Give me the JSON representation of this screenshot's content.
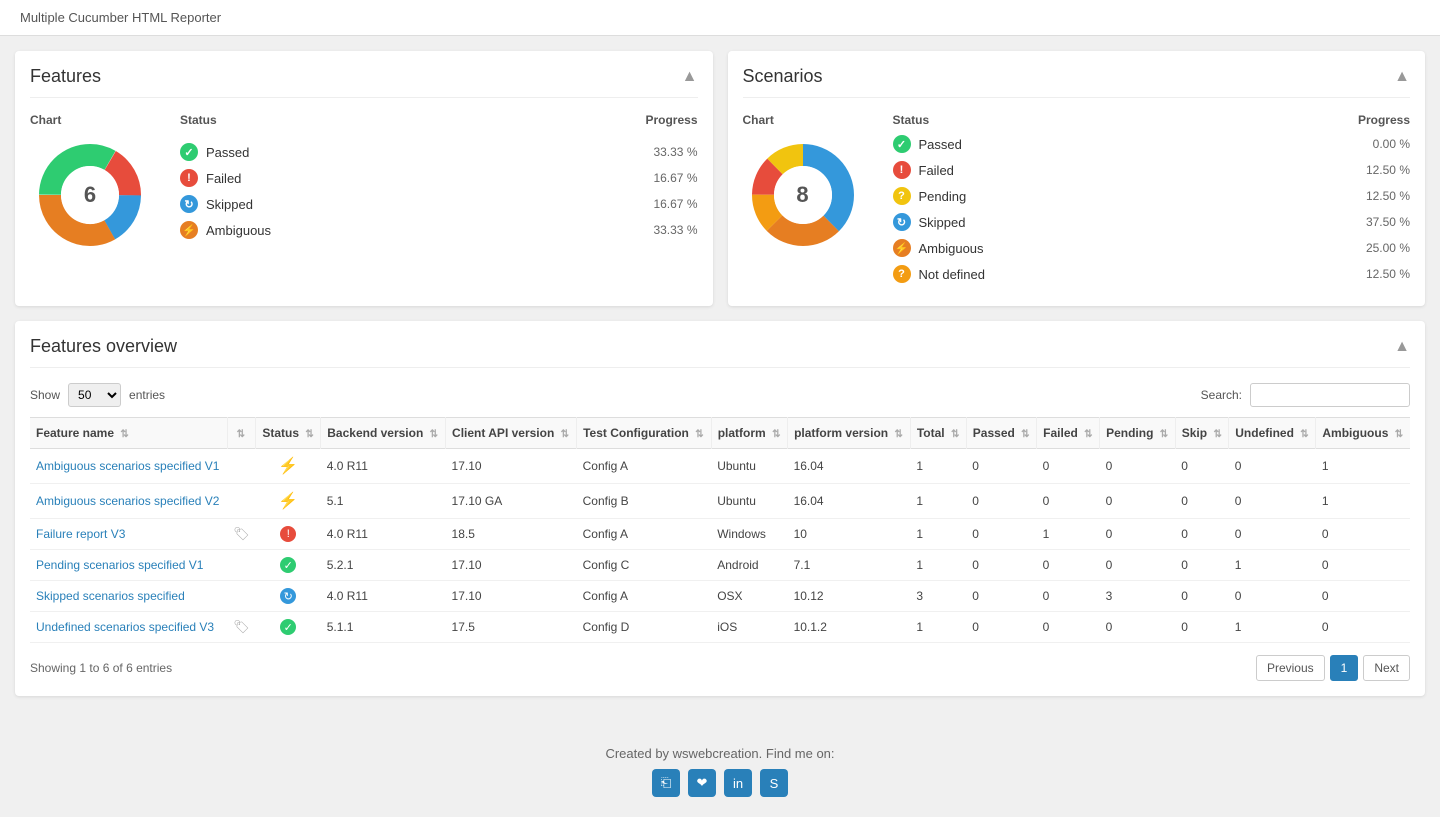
{
  "app": {
    "title": "Multiple Cucumber HTML Reporter"
  },
  "features_panel": {
    "title": "Features",
    "toggle": "▲",
    "col_chart": "Chart",
    "col_status": "Status",
    "col_progress": "Progress",
    "center_number": "6",
    "statuses": [
      {
        "label": "Passed",
        "type": "passed",
        "pct": "33.33 %"
      },
      {
        "label": "Failed",
        "type": "failed",
        "pct": "16.67 %"
      },
      {
        "label": "Skipped",
        "type": "skipped",
        "pct": "16.67 %"
      },
      {
        "label": "Ambiguous",
        "type": "ambiguous",
        "pct": "33.33 %"
      }
    ],
    "donut": {
      "segments": [
        {
          "color": "#2ecc71",
          "pct": 33.33
        },
        {
          "color": "#e74c3c",
          "pct": 16.67
        },
        {
          "color": "#3498db",
          "pct": 16.67
        },
        {
          "color": "#e67e22",
          "pct": 33.33
        }
      ]
    }
  },
  "scenarios_panel": {
    "title": "Scenarios",
    "toggle": "▲",
    "col_chart": "Chart",
    "col_status": "Status",
    "col_progress": "Progress",
    "center_number": "8",
    "statuses": [
      {
        "label": "Passed",
        "type": "passed",
        "pct": "0.00 %"
      },
      {
        "label": "Failed",
        "type": "failed",
        "pct": "12.50 %"
      },
      {
        "label": "Pending",
        "type": "pending",
        "pct": "12.50 %"
      },
      {
        "label": "Skipped",
        "type": "skipped",
        "pct": "37.50 %"
      },
      {
        "label": "Ambiguous",
        "type": "ambiguous",
        "pct": "25.00 %"
      },
      {
        "label": "Not defined",
        "type": "undefined",
        "pct": "12.50 %"
      }
    ],
    "donut": {
      "segments": [
        {
          "color": "#2ecc71",
          "pct": 0
        },
        {
          "color": "#e74c3c",
          "pct": 12.5
        },
        {
          "color": "#f1c40f",
          "pct": 12.5
        },
        {
          "color": "#3498db",
          "pct": 37.5
        },
        {
          "color": "#e67e22",
          "pct": 25
        },
        {
          "color": "#f39c12",
          "pct": 12.5
        }
      ]
    }
  },
  "overview": {
    "title": "Features overview",
    "toggle": "▲",
    "show_label": "Show",
    "show_value": "50",
    "entries_label": "entries",
    "search_label": "Search:",
    "search_placeholder": "",
    "showing_text": "Showing 1 to 6 of 6 entries",
    "columns": [
      "Feature name",
      "",
      "Status",
      "Backend version",
      "Client API version",
      "Test Configuration",
      "platform",
      "platform version",
      "Total",
      "Passed",
      "Failed",
      "Pending",
      "Skip",
      "Undefined",
      "Ambiguous"
    ],
    "rows": [
      {
        "name": "Ambiguous scenarios specified V1",
        "tag": false,
        "status": "ambiguous",
        "backend": "4.0 R11",
        "client_api": "17.10",
        "test_config": "Config A",
        "platform": "Ubuntu",
        "platform_version": "16.04",
        "total": 1,
        "passed": 0,
        "failed": 0,
        "pending": 0,
        "skip": 0,
        "undefined": 0,
        "ambiguous": 1
      },
      {
        "name": "Ambiguous scenarios specified V2",
        "tag": false,
        "status": "ambiguous",
        "backend": "5.1",
        "client_api": "17.10 GA",
        "test_config": "Config B",
        "platform": "Ubuntu",
        "platform_version": "16.04",
        "total": 1,
        "passed": 0,
        "failed": 0,
        "pending": 0,
        "skip": 0,
        "undefined": 0,
        "ambiguous": 1
      },
      {
        "name": "Failure report V3",
        "tag": true,
        "status": "failed",
        "backend": "4.0 R11",
        "client_api": "18.5",
        "test_config": "Config A",
        "platform": "Windows",
        "platform_version": "10",
        "total": 1,
        "passed": 0,
        "failed": 1,
        "pending": 0,
        "skip": 0,
        "undefined": 0,
        "ambiguous": 0
      },
      {
        "name": "Pending scenarios specified V1",
        "tag": false,
        "status": "passed",
        "backend": "5.2.1",
        "client_api": "17.10",
        "test_config": "Config C",
        "platform": "Android",
        "platform_version": "7.1",
        "total": 1,
        "passed": 0,
        "failed": 0,
        "pending": 0,
        "skip": 0,
        "undefined": 1,
        "ambiguous": 0
      },
      {
        "name": "Skipped scenarios specified",
        "tag": false,
        "status": "skipped",
        "backend": "4.0 R11",
        "client_api": "17.10",
        "test_config": "Config A",
        "platform": "OSX",
        "platform_version": "10.12",
        "total": 3,
        "passed": 0,
        "failed": 0,
        "pending": 3,
        "skip": 0,
        "undefined": 0,
        "ambiguous": 0
      },
      {
        "name": "Undefined scenarios specified V3",
        "tag": true,
        "status": "passed",
        "backend": "5.1.1",
        "client_api": "17.5",
        "test_config": "Config D",
        "platform": "iOS",
        "platform_version": "10.1.2",
        "total": 1,
        "passed": 0,
        "failed": 0,
        "pending": 0,
        "skip": 0,
        "undefined": 1,
        "ambiguous": 0
      }
    ]
  },
  "footer": {
    "text": "Created by wswebcreation. Find me on:"
  },
  "pagination": {
    "previous": "Previous",
    "next": "Next",
    "current": "1"
  }
}
